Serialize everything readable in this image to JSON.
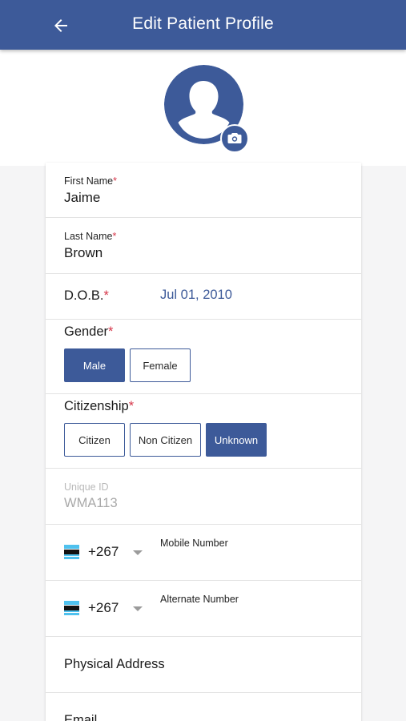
{
  "header": {
    "title": "Edit Patient Profile",
    "back_icon": "arrow-left-icon"
  },
  "colors": {
    "primary": "#3d5a99",
    "required": "#d6374a",
    "muted": "#a9a9a9"
  },
  "profile_photo": {
    "icon": "person-silhouette-icon",
    "camera_icon": "camera-icon"
  },
  "form": {
    "first_name": {
      "label": "First Name",
      "required": "*",
      "value": "Jaime"
    },
    "last_name": {
      "label": "Last Name",
      "required": "*",
      "value": "Brown"
    },
    "dob": {
      "label": "D.O.B.",
      "required": "*",
      "value": "Jul 01, 2010"
    },
    "gender": {
      "label": "Gender",
      "required": "*",
      "options": [
        "Male",
        "Female"
      ],
      "selected": "Male"
    },
    "citizenship": {
      "label": "Citizenship",
      "required": "*",
      "options": [
        "Citizen",
        "Non Citizen",
        "Unknown"
      ],
      "selected": "Unknown"
    },
    "unique_id": {
      "label": "Unique ID",
      "value": "WMA113"
    },
    "mobile": {
      "flag": "botswana-flag-icon",
      "code": "+267",
      "label": "Mobile Number",
      "value": ""
    },
    "alternate": {
      "flag": "botswana-flag-icon",
      "code": "+267",
      "label": "Alternate Number",
      "value": ""
    },
    "physical_address": {
      "label": "Physical Address"
    },
    "email": {
      "label": "Email"
    }
  }
}
